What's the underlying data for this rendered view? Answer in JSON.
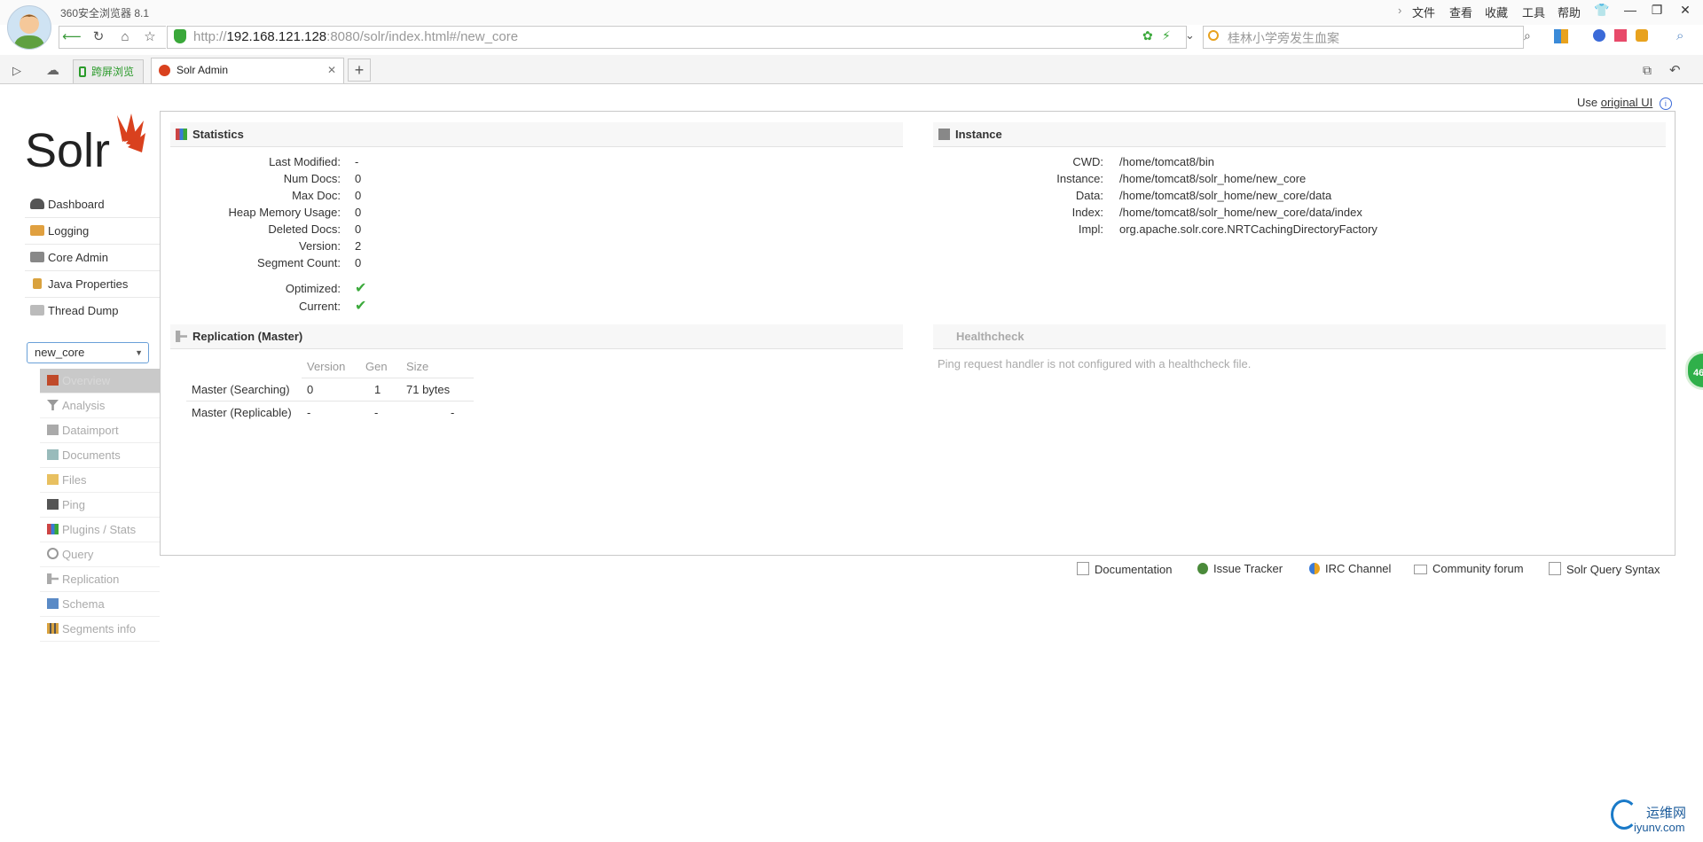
{
  "browser": {
    "app_title": "360安全浏览器 8.1",
    "menu": [
      "文件",
      "查看",
      "收藏",
      "工具",
      "帮助"
    ],
    "url_prefix": "http://",
    "url_host": "192.168.121.128",
    "url_rest": ":8080/solr/index.html#/new_core",
    "search_placeholder": "桂林小学旁发生血案",
    "tabs": [
      {
        "label": "跨屏浏览"
      },
      {
        "label": "Solr Admin"
      }
    ],
    "new_tab": "+"
  },
  "solr": {
    "use_ui_prefix": "Use",
    "use_ui_link": "original UI",
    "nav": [
      {
        "label": "Dashboard",
        "icon": "dashboard-icon",
        "color": "#555"
      },
      {
        "label": "Logging",
        "icon": "logging-icon",
        "color": "#e0a040"
      },
      {
        "label": "Core Admin",
        "icon": "core-admin-icon",
        "color": "#888"
      },
      {
        "label": "Java Properties",
        "icon": "java-properties-icon",
        "color": "#d9a23e"
      },
      {
        "label": "Thread Dump",
        "icon": "thread-dump-icon",
        "color": "#aaa"
      }
    ],
    "core_selector": "new_core",
    "core_nav": [
      {
        "label": "Overview",
        "icon": "home-icon",
        "color": "#c04a2a"
      },
      {
        "label": "Analysis",
        "icon": "funnel-icon",
        "color": "#888"
      },
      {
        "label": "Dataimport",
        "icon": "dataimport-icon",
        "color": "#999"
      },
      {
        "label": "Documents",
        "icon": "documents-icon",
        "color": "#8aa"
      },
      {
        "label": "Files",
        "icon": "files-icon",
        "color": "#e8c060"
      },
      {
        "label": "Ping",
        "icon": "ping-icon",
        "color": "#555"
      },
      {
        "label": "Plugins / Stats",
        "icon": "plugins-icon",
        "color": "#c44"
      },
      {
        "label": "Query",
        "icon": "query-icon",
        "color": "#888"
      },
      {
        "label": "Replication",
        "icon": "replication-icon",
        "color": "#888"
      },
      {
        "label": "Schema",
        "icon": "schema-icon",
        "color": "#5a8ac6"
      },
      {
        "label": "Segments info",
        "icon": "segments-icon",
        "color": "#d9a23e"
      }
    ],
    "statistics": {
      "title": "Statistics",
      "rows": [
        {
          "label": "Last Modified:",
          "value": "-"
        },
        {
          "label": "Num Docs:",
          "value": "0"
        },
        {
          "label": "Max Doc:",
          "value": "0"
        },
        {
          "label": "Heap Memory Usage:",
          "value": "0"
        },
        {
          "label": "Deleted Docs:",
          "value": "0"
        },
        {
          "label": "Version:",
          "value": "2"
        },
        {
          "label": "Segment Count:",
          "value": "0"
        }
      ],
      "flags": [
        {
          "label": "Optimized:",
          "value": "✔"
        },
        {
          "label": "Current:",
          "value": "✔"
        }
      ]
    },
    "instance": {
      "title": "Instance",
      "rows": [
        {
          "label": "CWD:",
          "value": "/home/tomcat8/bin"
        },
        {
          "label": "Instance:",
          "value": "/home/tomcat8/solr_home/new_core"
        },
        {
          "label": "Data:",
          "value": "/home/tomcat8/solr_home/new_core/data"
        },
        {
          "label": "Index:",
          "value": "/home/tomcat8/solr_home/new_core/data/index"
        },
        {
          "label": "Impl:",
          "value": "org.apache.solr.core.NRTCachingDirectoryFactory"
        }
      ]
    },
    "replication": {
      "title": "Replication (Master)",
      "headers": [
        "Version",
        "Gen",
        "Size"
      ],
      "rows": [
        {
          "name": "Master (Searching)",
          "version": "0",
          "gen": "1",
          "size": "71 bytes"
        },
        {
          "name": "Master (Replicable)",
          "version": "-",
          "gen": "-",
          "size": "-"
        }
      ]
    },
    "healthcheck": {
      "title": "Healthcheck",
      "message": "Ping request handler is not configured with a healthcheck file."
    },
    "footer": [
      {
        "label": "Documentation",
        "icon": "documentation-icon"
      },
      {
        "label": "Issue Tracker",
        "icon": "bug-icon"
      },
      {
        "label": "IRC Channel",
        "icon": "irc-icon"
      },
      {
        "label": "Community forum",
        "icon": "mail-icon"
      },
      {
        "label": "Solr Query Syntax",
        "icon": "query-syntax-icon"
      }
    ]
  },
  "watermark": {
    "line1": "运维网",
    "line2": "iyunv.com"
  },
  "side_badge": "46"
}
